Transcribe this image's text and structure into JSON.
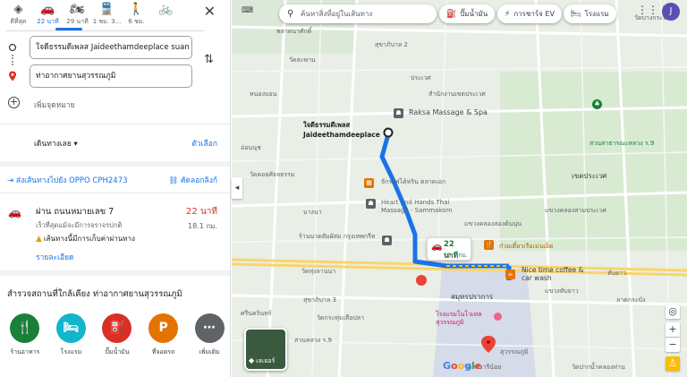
{
  "travel_modes": [
    {
      "icon": "directions-icon",
      "glyph": "◈",
      "label": "ดีที่สุด"
    },
    {
      "icon": "car-icon",
      "glyph": "🚗",
      "label": "22 นาที"
    },
    {
      "icon": "motorcycle-icon",
      "glyph": "🏍",
      "label": "29 นาที"
    },
    {
      "icon": "transit-icon",
      "glyph": "🚆",
      "label": "1 ชม. 3..."
    },
    {
      "icon": "walk-icon",
      "glyph": "🚶",
      "label": "6 ชม."
    },
    {
      "icon": "bicycle-icon",
      "glyph": "🚲",
      "label": ""
    }
  ],
  "close_glyph": "✕",
  "origin": {
    "value": "ใจดีธรรมดีเพลส Jaideethamdeeplace suan"
  },
  "destination": {
    "value": "ท่าอากาศยานสุวรรณภูมิ"
  },
  "swap_glyph": "⇅",
  "add_destination": "เพิ่มจุดหมาย",
  "depart_now": "เดินทางเลย ▾",
  "options": "ตัวเลือก",
  "send_to_device": "ส่งเส้นทางไปยัง OPPO CPH2473",
  "copy_link": "คัดลอกลิงก์",
  "route": {
    "via": "ผ่าน ถนนหมายเลข 7",
    "duration": "22 นาที",
    "subtitle": "เร็วที่สุดแม้จะมีการจราจรปกติ",
    "distance": "18.1 กม.",
    "warning": "เส้นทางนี้มีการเก็บค่าผ่านทาง",
    "details": "รายละเอียด"
  },
  "explore_title": "สำรวจสถานที่ใกล้เคียง ท่าอากาศยานสุวรรณภูมิ",
  "categories": [
    {
      "label": "ร้านอาหาร",
      "icon": "restaurant-icon",
      "glyph": "🍴",
      "color": "#188038"
    },
    {
      "label": "โรงแรม",
      "icon": "hotel-icon",
      "glyph": "🛏",
      "color": "#12b5cb"
    },
    {
      "label": "ปั๊มน้ำมัน",
      "icon": "gas-station-icon",
      "glyph": "⛽",
      "color": "#d93025"
    },
    {
      "label": "ที่จอดรถ",
      "icon": "parking-icon",
      "glyph": "P",
      "color": "#e37400"
    },
    {
      "label": "เพิ่มเติม",
      "icon": "more-icon",
      "glyph": "⋯",
      "color": "#5f6368"
    }
  ],
  "map": {
    "search_placeholder": "ค้นหาสิ่งที่อยู่ในเส้นทาง",
    "chips": [
      {
        "label": "ปั๊มน้ำมัน",
        "icon": "gas-station-icon",
        "glyph": "⛽"
      },
      {
        "label": "การชาร์จ EV",
        "icon": "ev-charge-icon",
        "glyph": "⚡"
      },
      {
        "label": "โรงแรม",
        "icon": "hotel-icon",
        "glyph": "🛏"
      }
    ],
    "avatar_letter": "J",
    "origin_label": "ใจดีธรรมดีเพลส\nJaideethamdeeplace",
    "route_duration": "22 นาที",
    "route_distance": "18.1 กม.",
    "layers_label": "เลเยอร์",
    "google": "Google",
    "labels": [
      "ประเวศ",
      "พลาดนาศักดิ์",
      "วัดสะพาน",
      "สวนสาธารณะหลวง ร.9",
      "เขตประเวศ",
      "สุขาภิบาล 2",
      "หนองบอน",
      "บางนา",
      "สำนักงานเขตประเวศ",
      "แขวงคลองสองต้นนุ่น",
      "วัดทุ่งลานนา",
      "แขวงคลองสามประเวศ",
      "แขวงทับยาว",
      "Raksa Massage & Spa",
      "Heart and Hands Thai Massage - Sammakorn",
      "Nice time coffee & car wash",
      "ก๋วยเตี๋ยวเรือเม่นเอ็ด",
      "ร้านนวดสัมผัสม กรุงเทพกรีท",
      "จักรไฟได้หริน ตลาดเอก",
      "โรงแรมโนโวเทล สุวรรณภูมิ",
      "สมุทรปราการ",
      "วัดกระทุ่มเสือปลา",
      "วัดปากน้ำคลองท่าน",
      "อ่อนนุช",
      "ลาดกระบัง",
      "วัดคอยศัจจธรรม",
      "ทับยาว",
      "วัดบางกระบือ",
      "สุขาภิบาล 3",
      "ศรีนครินทร์",
      "วัดศรีวารีน้อย",
      "สวนหลวง ร.9",
      "สุวรรณภูมิ"
    ]
  }
}
